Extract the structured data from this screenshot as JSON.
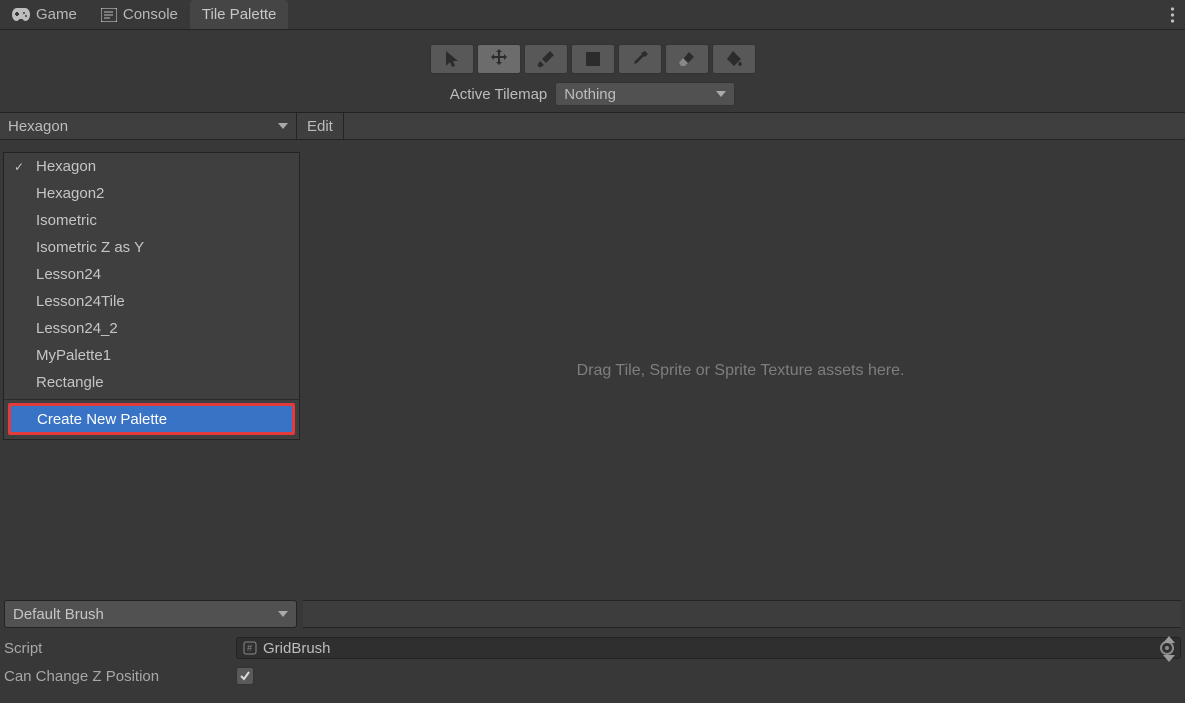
{
  "tabs": [
    {
      "label": "Game",
      "icon": "gamepad-icon"
    },
    {
      "label": "Console",
      "icon": "console-icon"
    },
    {
      "label": "Tile Palette",
      "icon": ""
    }
  ],
  "active_tab_index": 2,
  "toolbar": {
    "active_tilemap_label": "Active Tilemap",
    "active_tilemap_value": "Nothing",
    "edit_label": "Edit"
  },
  "palette_dropdown": {
    "selected": "Hexagon",
    "items": [
      "Hexagon",
      "Hexagon2",
      "Isometric",
      "Isometric Z as Y",
      "Lesson24",
      "Lesson24Tile",
      "Lesson24_2",
      "MyPalette1",
      "Rectangle"
    ],
    "checked_index": 0,
    "create_label": "Create New Palette"
  },
  "drop_hint": "Drag Tile, Sprite or Sprite Texture assets here.",
  "brush": {
    "selected": "Default Brush"
  },
  "inspector": {
    "script_label": "Script",
    "script_value": "GridBrush",
    "canchange_label": "Can Change Z Position",
    "canchange_checked": true
  }
}
